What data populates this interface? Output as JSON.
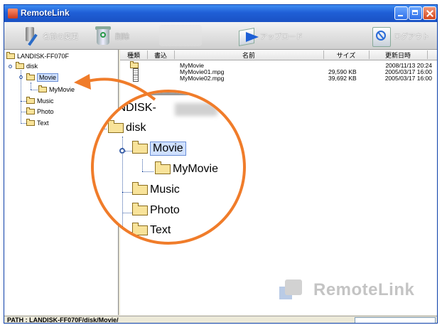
{
  "window": {
    "title": "RemoteLink"
  },
  "toolbar": {
    "rename_label": "名前の変更",
    "delete_label": "削除",
    "upload_label": "アップロード",
    "logout_label": "ログアウト"
  },
  "tree": {
    "root": "LANDISK-FF070F",
    "disk": "disk",
    "movie": "Movie",
    "mymovie": "MyMovie",
    "music": "Music",
    "photo": "Photo",
    "text": "Text"
  },
  "list": {
    "columns": [
      "種類",
      "書込",
      "名前",
      "サイズ",
      "更新日時"
    ],
    "rows": [
      {
        "name": "MyMovie",
        "size": "",
        "date": "2008/11/13 20:24"
      },
      {
        "name": "MyMovie01.mpg",
        "size": "29,590 KB",
        "date": "2005/03/17 16:00"
      },
      {
        "name": "MyMovie02.mpg",
        "size": "39,692 KB",
        "date": "2005/03/17 16:00"
      }
    ]
  },
  "zoom": {
    "root": "LANDISK-",
    "disk": "disk",
    "movie": "Movie",
    "mymovie": "MyMovie",
    "music": "Music",
    "photo": "Photo",
    "text": "Text"
  },
  "watermark": {
    "text": "RemoteLink"
  },
  "status": {
    "path": "PATH : LANDISK-FF070F/disk/Movie/"
  },
  "colors": {
    "accent": "#f07c2a",
    "titlebar": "#1f5fd6",
    "selection": "#cfe0ff"
  }
}
